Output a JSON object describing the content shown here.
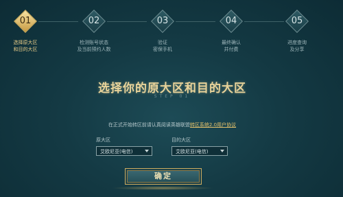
{
  "steps": [
    {
      "num": "01",
      "label": "选择原大区\n和目的大区"
    },
    {
      "num": "02",
      "label": "检测账号状态\n及当前预约人数"
    },
    {
      "num": "03",
      "label": "验证\n密保手机"
    },
    {
      "num": "04",
      "label": "最终确认\n并付费"
    },
    {
      "num": "05",
      "label": "进度查询\n及分享"
    }
  ],
  "main": {
    "headline": "选择你的原大区和目的大区",
    "step_caption": "STEP 01",
    "agreement_prefix": "在正式开始转区前请认真阅读英雄联盟",
    "agreement_link": "转区系统2.0用户协议",
    "source": {
      "label": "原大区",
      "value": "艾欧尼亚(电信)"
    },
    "target": {
      "label": "目的大区",
      "value": "艾欧尼亚(电信)"
    },
    "confirm_label": "确定"
  },
  "colors": {
    "accent": "#e6c26b",
    "background": "#143a44"
  }
}
